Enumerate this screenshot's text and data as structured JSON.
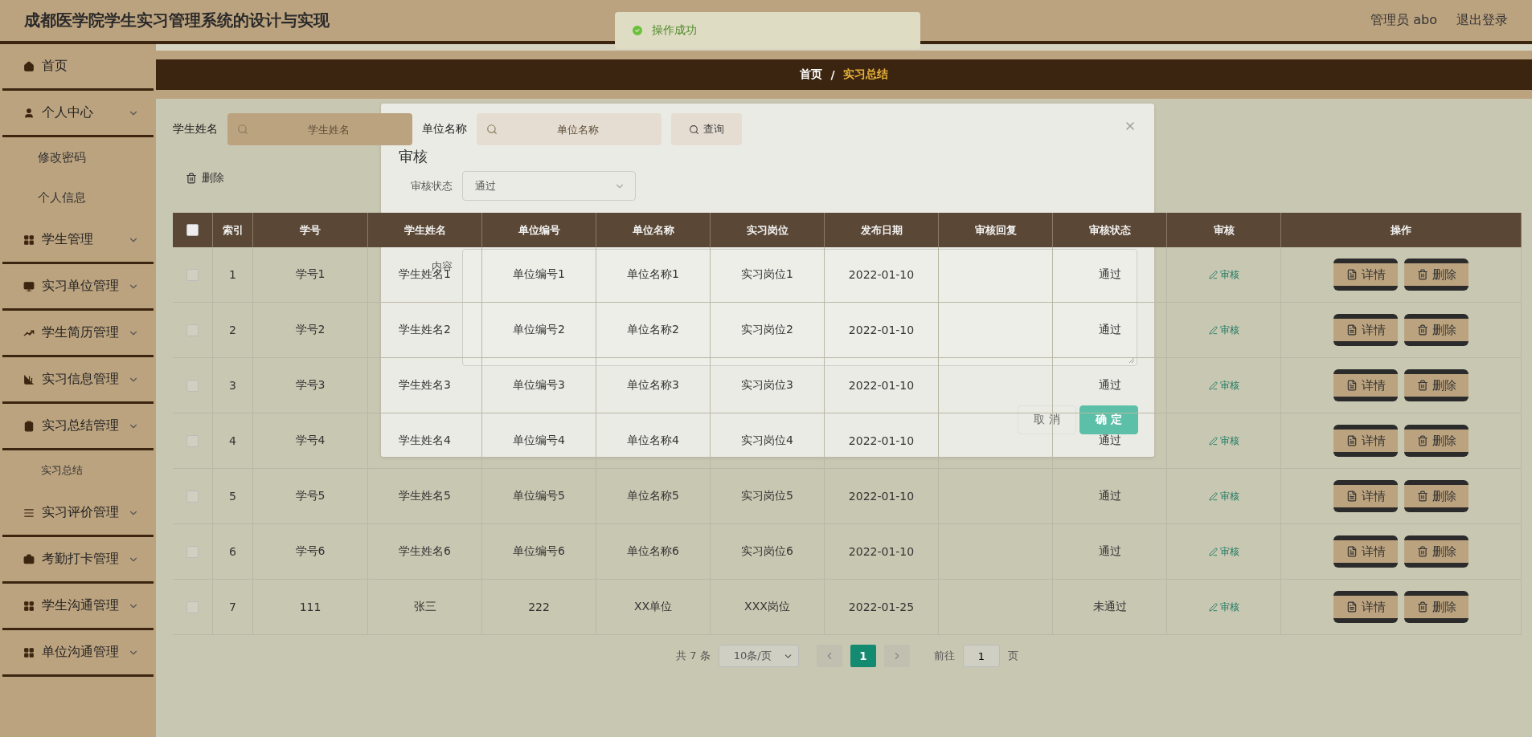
{
  "header": {
    "title": "成都医学院学生实习管理系统的设计与实现",
    "user": "管理员 abo",
    "logout": "退出登录"
  },
  "toast": {
    "text": "操作成功"
  },
  "sidebar": {
    "items": [
      {
        "kind": "link",
        "label": "首页"
      },
      {
        "kind": "group",
        "label": "个人中心",
        "children": [
          {
            "label": "修改密码"
          },
          {
            "label": "个人信息"
          }
        ]
      },
      {
        "kind": "group",
        "label": "学生管理"
      },
      {
        "kind": "group",
        "label": "实习单位管理"
      },
      {
        "kind": "group",
        "label": "学生简历管理"
      },
      {
        "kind": "group",
        "label": "实习信息管理"
      },
      {
        "kind": "group",
        "label": "实习总结管理",
        "children": [
          {
            "label": "实习总结"
          }
        ]
      },
      {
        "kind": "group",
        "label": "实习评价管理"
      },
      {
        "kind": "group",
        "label": "考勤打卡管理"
      },
      {
        "kind": "group",
        "label": "学生沟通管理"
      },
      {
        "kind": "group",
        "label": "单位沟通管理"
      }
    ]
  },
  "breadcrumb": [
    {
      "label": "首页",
      "selected": false
    },
    {
      "label": "实习总结",
      "selected": true
    }
  ],
  "breadcrumb_separator": "/",
  "search": {
    "fields": [
      {
        "label": "学生姓名",
        "placeholder": "学生姓名"
      },
      {
        "label": "单位名称",
        "placeholder": "单位名称"
      }
    ],
    "button": "查询"
  },
  "toolbar": {
    "delete": "删除"
  },
  "table": {
    "header_checked": false,
    "columns": [
      "索引",
      "学号",
      "学生姓名",
      "单位编号",
      "单位名称",
      "实习岗位",
      "发布日期",
      "审核回复",
      "审核状态",
      "审核",
      "操作"
    ],
    "rows": [
      {
        "checked": false,
        "cells": [
          "1",
          "学号1",
          "学生姓名1",
          "单位编号1",
          "单位名称1",
          "实习岗位1",
          "2022-01-10",
          "",
          "通过"
        ],
        "review": "审核",
        "actions": [
          {
            "kind": "detail",
            "label": "详情"
          },
          {
            "kind": "delete",
            "label": "删除"
          }
        ]
      },
      {
        "checked": false,
        "cells": [
          "2",
          "学号2",
          "学生姓名2",
          "单位编号2",
          "单位名称2",
          "实习岗位2",
          "2022-01-10",
          "",
          "通过"
        ],
        "review": "审核",
        "actions": [
          {
            "kind": "detail",
            "label": "详情"
          },
          {
            "kind": "delete",
            "label": "删除"
          }
        ]
      },
      {
        "checked": false,
        "cells": [
          "3",
          "学号3",
          "学生姓名3",
          "单位编号3",
          "单位名称3",
          "实习岗位3",
          "2022-01-10",
          "",
          "通过"
        ],
        "review": "审核",
        "actions": [
          {
            "kind": "detail",
            "label": "详情"
          },
          {
            "kind": "delete",
            "label": "删除"
          }
        ]
      },
      {
        "checked": false,
        "cells": [
          "4",
          "学号4",
          "学生姓名4",
          "单位编号4",
          "单位名称4",
          "实习岗位4",
          "2022-01-10",
          "",
          "通过"
        ],
        "review": "审核",
        "actions": [
          {
            "kind": "detail",
            "label": "详情"
          },
          {
            "kind": "delete",
            "label": "删除"
          }
        ]
      },
      {
        "checked": false,
        "cells": [
          "5",
          "学号5",
          "学生姓名5",
          "单位编号5",
          "单位名称5",
          "实习岗位5",
          "2022-01-10",
          "",
          "通过"
        ],
        "review": "审核",
        "actions": [
          {
            "kind": "detail",
            "label": "详情"
          },
          {
            "kind": "delete",
            "label": "删除"
          }
        ]
      },
      {
        "checked": false,
        "cells": [
          "6",
          "学号6",
          "学生姓名6",
          "单位编号6",
          "单位名称6",
          "实习岗位6",
          "2022-01-10",
          "",
          "通过"
        ],
        "review": "审核",
        "actions": [
          {
            "kind": "detail",
            "label": "详情"
          },
          {
            "kind": "delete",
            "label": "删除"
          }
        ]
      },
      {
        "checked": false,
        "cells": [
          "7",
          "111",
          "张三",
          "222",
          "XX单位",
          "XXX岗位",
          "2022-01-25",
          "",
          "未通过"
        ],
        "review": "审核",
        "actions": [
          {
            "kind": "detail",
            "label": "详情"
          },
          {
            "kind": "delete",
            "label": "删除"
          }
        ]
      }
    ]
  },
  "pagination": {
    "total": "共 7 条",
    "page_size": "10条/页",
    "pages": [
      {
        "label": "1",
        "selected": true
      }
    ],
    "goto": "前往",
    "goto_value": "1",
    "page_unit": "页"
  },
  "dialog": {
    "title": "审核",
    "status_label": "审核状态",
    "status_value": "通过",
    "content_label": "内容",
    "buttons": [
      {
        "kind": "cancel",
        "label": "取 消"
      },
      {
        "kind": "confirm",
        "label": "确 定"
      }
    ]
  }
}
